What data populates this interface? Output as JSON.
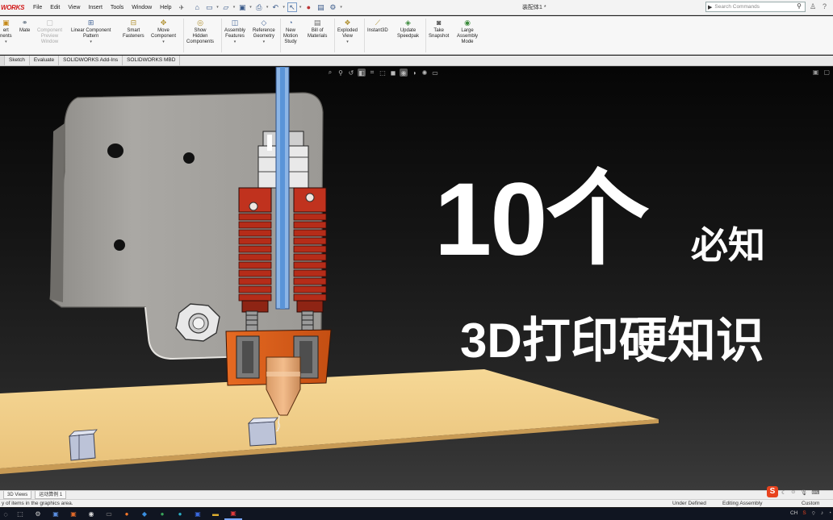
{
  "app": {
    "logo_text": "WORKS",
    "menus": [
      "File",
      "Edit",
      "View",
      "Insert",
      "Tools",
      "Window",
      "Help"
    ],
    "pin_icon": "pin-icon",
    "document_title": "装配体1 *",
    "search_placeholder": "Search Commands"
  },
  "ribbon": {
    "tools": [
      {
        "id": "insert-components",
        "label": "ert\nnents",
        "icon": "insert-component-icon",
        "disabled": false
      },
      {
        "id": "mate",
        "label": "Mate",
        "icon": "mate-icon",
        "disabled": false
      },
      {
        "id": "component-preview",
        "label": "Component\nPreview\nWindow",
        "icon": "preview-window-icon",
        "disabled": true
      },
      {
        "id": "linear-pattern",
        "label": "Linear Component\nPattern",
        "icon": "pattern-icon",
        "disabled": false
      },
      {
        "id": "smart-fasteners",
        "label": "Smart\nFasteners",
        "icon": "fastener-icon",
        "disabled": false
      },
      {
        "id": "move-component",
        "label": "Move\nComponent",
        "icon": "move-icon",
        "disabled": false
      },
      {
        "id": "show-hidden",
        "label": "Show\nHidden\nComponents",
        "icon": "show-hidden-icon",
        "disabled": false
      },
      {
        "id": "assembly-features",
        "label": "Assembly\nFeatures",
        "icon": "assembly-features-icon",
        "disabled": false
      },
      {
        "id": "reference-geometry",
        "label": "Reference\nGeometry",
        "icon": "reference-geometry-icon",
        "disabled": false
      },
      {
        "id": "new-motion-study",
        "label": "New\nMotion\nStudy",
        "icon": "motion-study-icon",
        "disabled": false
      },
      {
        "id": "bill-of-materials",
        "label": "Bill of\nMaterials",
        "icon": "bom-icon",
        "disabled": false
      },
      {
        "id": "exploded-view",
        "label": "Exploded\nView",
        "icon": "exploded-view-icon",
        "disabled": false
      },
      {
        "id": "instant3d",
        "label": "Instant3D",
        "icon": "instant3d-icon",
        "disabled": false
      },
      {
        "id": "update-speedpak",
        "label": "Update\nSpeedpak",
        "icon": "speedpak-icon",
        "disabled": false
      },
      {
        "id": "take-snapshot",
        "label": "Take\nSnapshot",
        "icon": "camera-icon",
        "disabled": false
      },
      {
        "id": "large-assembly",
        "label": "Large\nAssembly\nMode",
        "icon": "large-assembly-icon",
        "disabled": false
      }
    ]
  },
  "tabs": [
    "Sketch",
    "Evaluate",
    "SOLIDWORKS Add-Ins",
    "SOLIDWORKS MBD"
  ],
  "overlay": {
    "big": "10个",
    "small": "必知",
    "sub": "3D打印硬知识"
  },
  "bottom_tabs": [
    "3D Views",
    "运动算例 1"
  ],
  "status": {
    "left": "y of items in the graphics area.",
    "definition": "Under Defined",
    "mode": "Editing Assembly",
    "units": "Custom"
  },
  "taskbar": {
    "ime": "CH"
  },
  "colors": {
    "viewport_bg": "#151515",
    "hotend_red": "#c0321e",
    "plate_gray": "#a9a7a3",
    "bed_yellow": "#f2d08c",
    "nozzle_copper": "#e7a875",
    "filament_blue": "#5a94d8"
  }
}
